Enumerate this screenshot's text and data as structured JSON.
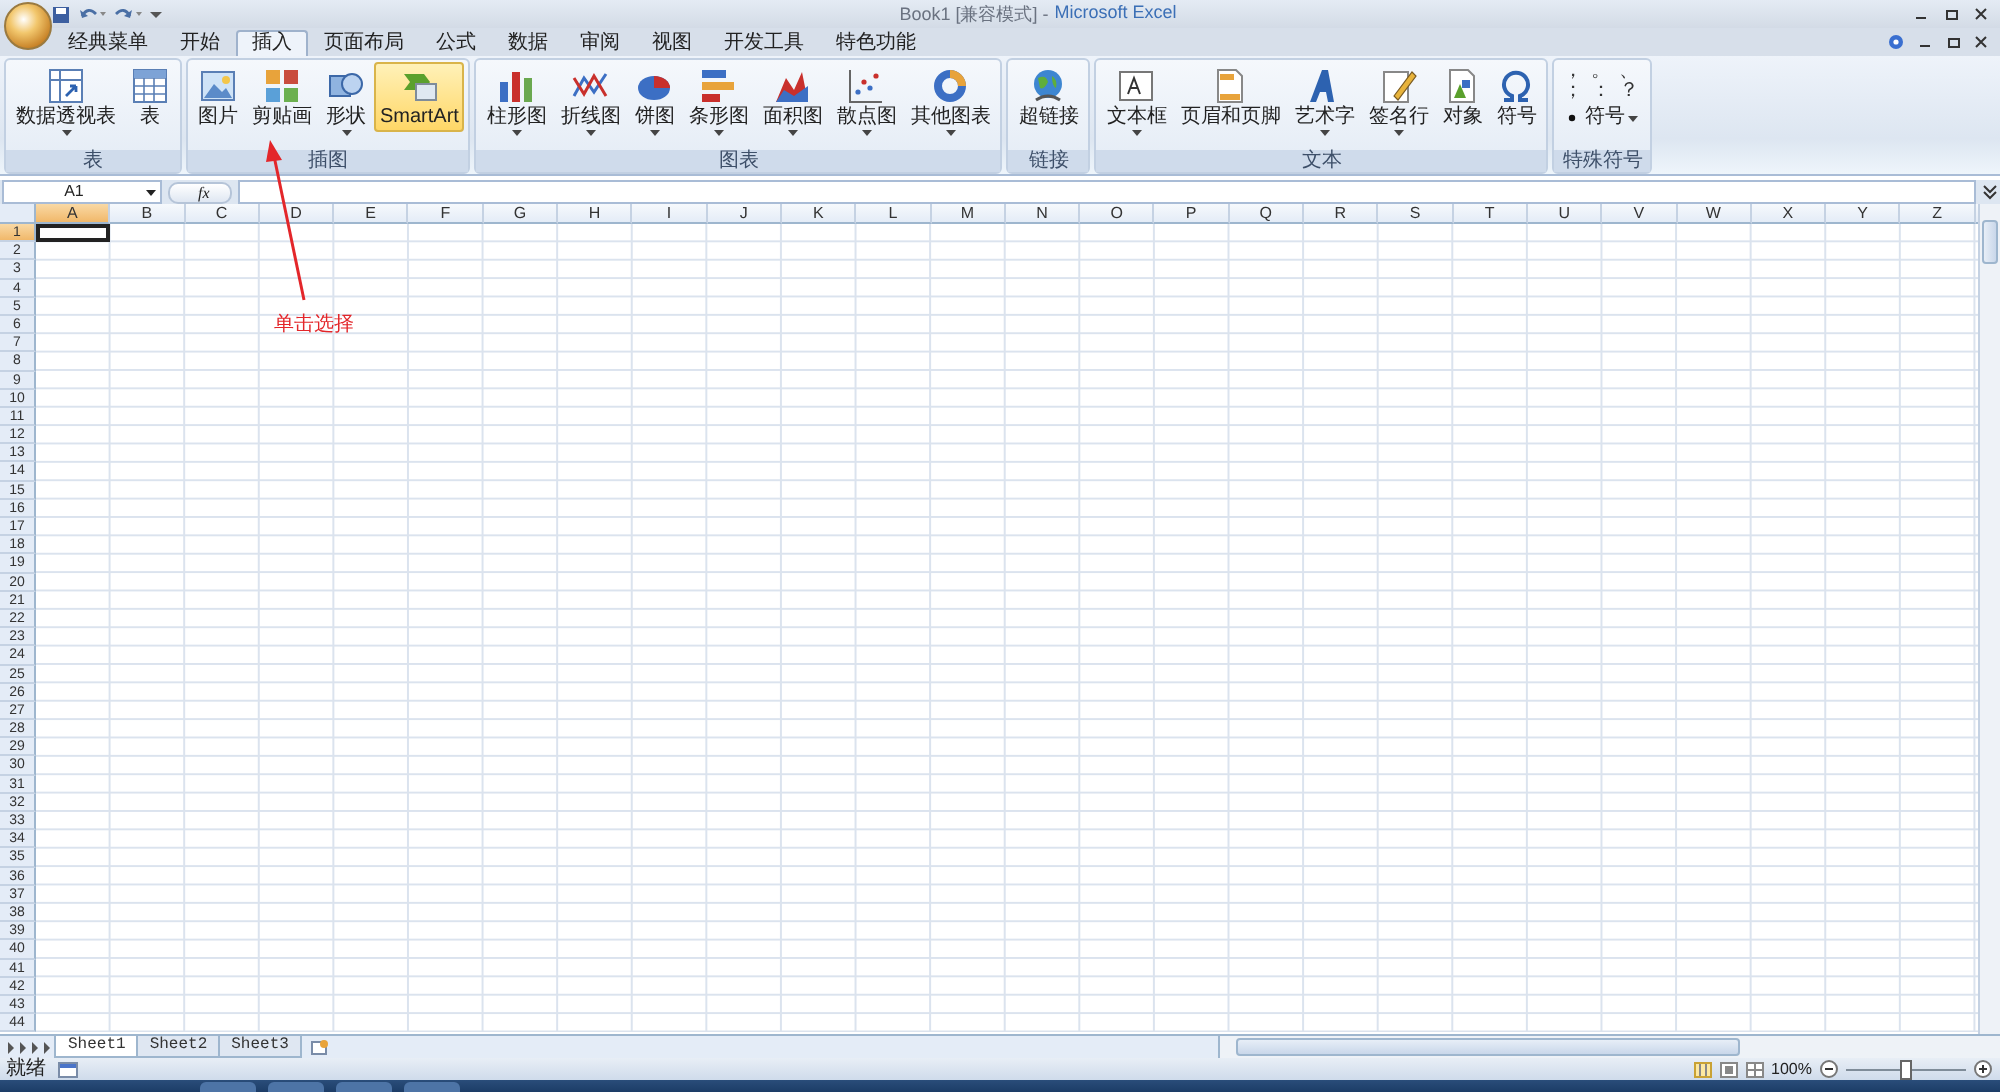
{
  "window": {
    "title": "Book1  [兼容模式] -",
    "app_name": "Microsoft Excel"
  },
  "tabs": [
    {
      "label": "经典菜单",
      "selected": false
    },
    {
      "label": "开始",
      "selected": false
    },
    {
      "label": "插入",
      "selected": true
    },
    {
      "label": "页面布局",
      "selected": false
    },
    {
      "label": "公式",
      "selected": false
    },
    {
      "label": "数据",
      "selected": false
    },
    {
      "label": "审阅",
      "selected": false
    },
    {
      "label": "视图",
      "selected": false
    },
    {
      "label": "开发工具",
      "selected": false
    },
    {
      "label": "特色功能",
      "selected": false
    }
  ],
  "ribbon": {
    "groups": [
      {
        "label": "表",
        "buttons": [
          {
            "label": "数据透视表",
            "dropdown": true,
            "selected": false
          },
          {
            "label": "表",
            "dropdown": false,
            "selected": false
          }
        ]
      },
      {
        "label": "插图",
        "buttons": [
          {
            "label": "图片",
            "dropdown": false,
            "selected": false
          },
          {
            "label": "剪贴画",
            "dropdown": false,
            "selected": false
          },
          {
            "label": "形状",
            "dropdown": true,
            "selected": false
          },
          {
            "label": "SmartArt",
            "dropdown": false,
            "selected": true
          }
        ]
      },
      {
        "label": "图表",
        "buttons": [
          {
            "label": "柱形图",
            "dropdown": true,
            "selected": false
          },
          {
            "label": "折线图",
            "dropdown": true,
            "selected": false
          },
          {
            "label": "饼图",
            "dropdown": true,
            "selected": false
          },
          {
            "label": "条形图",
            "dropdown": true,
            "selected": false
          },
          {
            "label": "面积图",
            "dropdown": true,
            "selected": false
          },
          {
            "label": "散点图",
            "dropdown": true,
            "selected": false
          },
          {
            "label": "其他图表",
            "dropdown": true,
            "selected": false
          }
        ]
      },
      {
        "label": "链接",
        "buttons": [
          {
            "label": "超链接",
            "dropdown": false,
            "selected": false
          }
        ]
      },
      {
        "label": "文本",
        "buttons": [
          {
            "label": "文本框",
            "dropdown": true,
            "selected": false
          },
          {
            "label": "页眉和页脚",
            "dropdown": false,
            "selected": false
          },
          {
            "label": "艺术字",
            "dropdown": true,
            "selected": false
          },
          {
            "label": "签名行",
            "dropdown": true,
            "selected": false
          },
          {
            "label": "对象",
            "dropdown": false,
            "selected": false
          },
          {
            "label": "符号",
            "dropdown": false,
            "selected": false
          }
        ]
      },
      {
        "label": "特殊符号",
        "symbols": [
          "，",
          "。",
          "、",
          "；",
          "：",
          "？"
        ],
        "buttons": [
          {
            "label": "符号",
            "dropdown": true,
            "selected": false
          }
        ]
      }
    ]
  },
  "formula_bar": {
    "name_box": "A1",
    "function_label": "fx"
  },
  "sheet": {
    "columns": [
      {
        "label": "A",
        "selected": true
      },
      {
        "label": "B",
        "selected": false
      },
      {
        "label": "C",
        "selected": false
      },
      {
        "label": "D",
        "selected": false
      },
      {
        "label": "E",
        "selected": false
      },
      {
        "label": "F",
        "selected": false
      },
      {
        "label": "G",
        "selected": false
      },
      {
        "label": "H",
        "selected": false
      },
      {
        "label": "I",
        "selected": false
      },
      {
        "label": "J",
        "selected": false
      },
      {
        "label": "K",
        "selected": false
      },
      {
        "label": "L",
        "selected": false
      },
      {
        "label": "M",
        "selected": false
      },
      {
        "label": "N",
        "selected": false
      },
      {
        "label": "O",
        "selected": false
      },
      {
        "label": "P",
        "selected": false
      },
      {
        "label": "Q",
        "selected": false
      },
      {
        "label": "R",
        "selected": false
      },
      {
        "label": "S",
        "selected": false
      },
      {
        "label": "T",
        "selected": false
      },
      {
        "label": "U",
        "selected": false
      },
      {
        "label": "V",
        "selected": false
      },
      {
        "label": "W",
        "selected": false
      },
      {
        "label": "X",
        "selected": false
      },
      {
        "label": "Y",
        "selected": false
      },
      {
        "label": "Z",
        "selected": false
      }
    ],
    "rows": [
      {
        "label": "1",
        "selected": true
      },
      {
        "label": "2",
        "selected": false
      },
      {
        "label": "3",
        "selected": false
      },
      {
        "label": "4",
        "selected": false
      },
      {
        "label": "5",
        "selected": false
      },
      {
        "label": "6",
        "selected": false
      },
      {
        "label": "7",
        "selected": false
      },
      {
        "label": "8",
        "selected": false
      },
      {
        "label": "9",
        "selected": false
      },
      {
        "label": "10",
        "selected": false
      },
      {
        "label": "11",
        "selected": false
      },
      {
        "label": "12",
        "selected": false
      },
      {
        "label": "13",
        "selected": false
      },
      {
        "label": "14",
        "selected": false
      },
      {
        "label": "15",
        "selected": false
      },
      {
        "label": "16",
        "selected": false
      },
      {
        "label": "17",
        "selected": false
      },
      {
        "label": "18",
        "selected": false
      },
      {
        "label": "19",
        "selected": false
      },
      {
        "label": "20",
        "selected": false
      },
      {
        "label": "21",
        "selected": false
      },
      {
        "label": "22",
        "selected": false
      },
      {
        "label": "23",
        "selected": false
      },
      {
        "label": "24",
        "selected": false
      },
      {
        "label": "25",
        "selected": false
      },
      {
        "label": "26",
        "selected": false
      },
      {
        "label": "27",
        "selected": false
      },
      {
        "label": "28",
        "selected": false
      },
      {
        "label": "29",
        "selected": false
      },
      {
        "label": "30",
        "selected": false
      },
      {
        "label": "31",
        "selected": false
      },
      {
        "label": "32",
        "selected": false
      },
      {
        "label": "33",
        "selected": false
      },
      {
        "label": "34",
        "selected": false
      },
      {
        "label": "35",
        "selected": false
      },
      {
        "label": "36",
        "selected": false
      },
      {
        "label": "37",
        "selected": false
      },
      {
        "label": "38",
        "selected": false
      },
      {
        "label": "39",
        "selected": false
      },
      {
        "label": "40",
        "selected": false
      },
      {
        "label": "41",
        "selected": false
      },
      {
        "label": "42",
        "selected": false
      },
      {
        "label": "43",
        "selected": false
      },
      {
        "label": "44",
        "selected": false
      }
    ]
  },
  "annotation": {
    "text": "单击选择"
  },
  "sheet_tabs": [
    {
      "label": "Sheet1",
      "selected": true
    },
    {
      "label": "Sheet2",
      "selected": false
    },
    {
      "label": "Sheet3",
      "selected": false
    }
  ],
  "status_bar": {
    "status": "就绪",
    "zoom": {
      "reading": "100%",
      "level": 0.5
    }
  }
}
